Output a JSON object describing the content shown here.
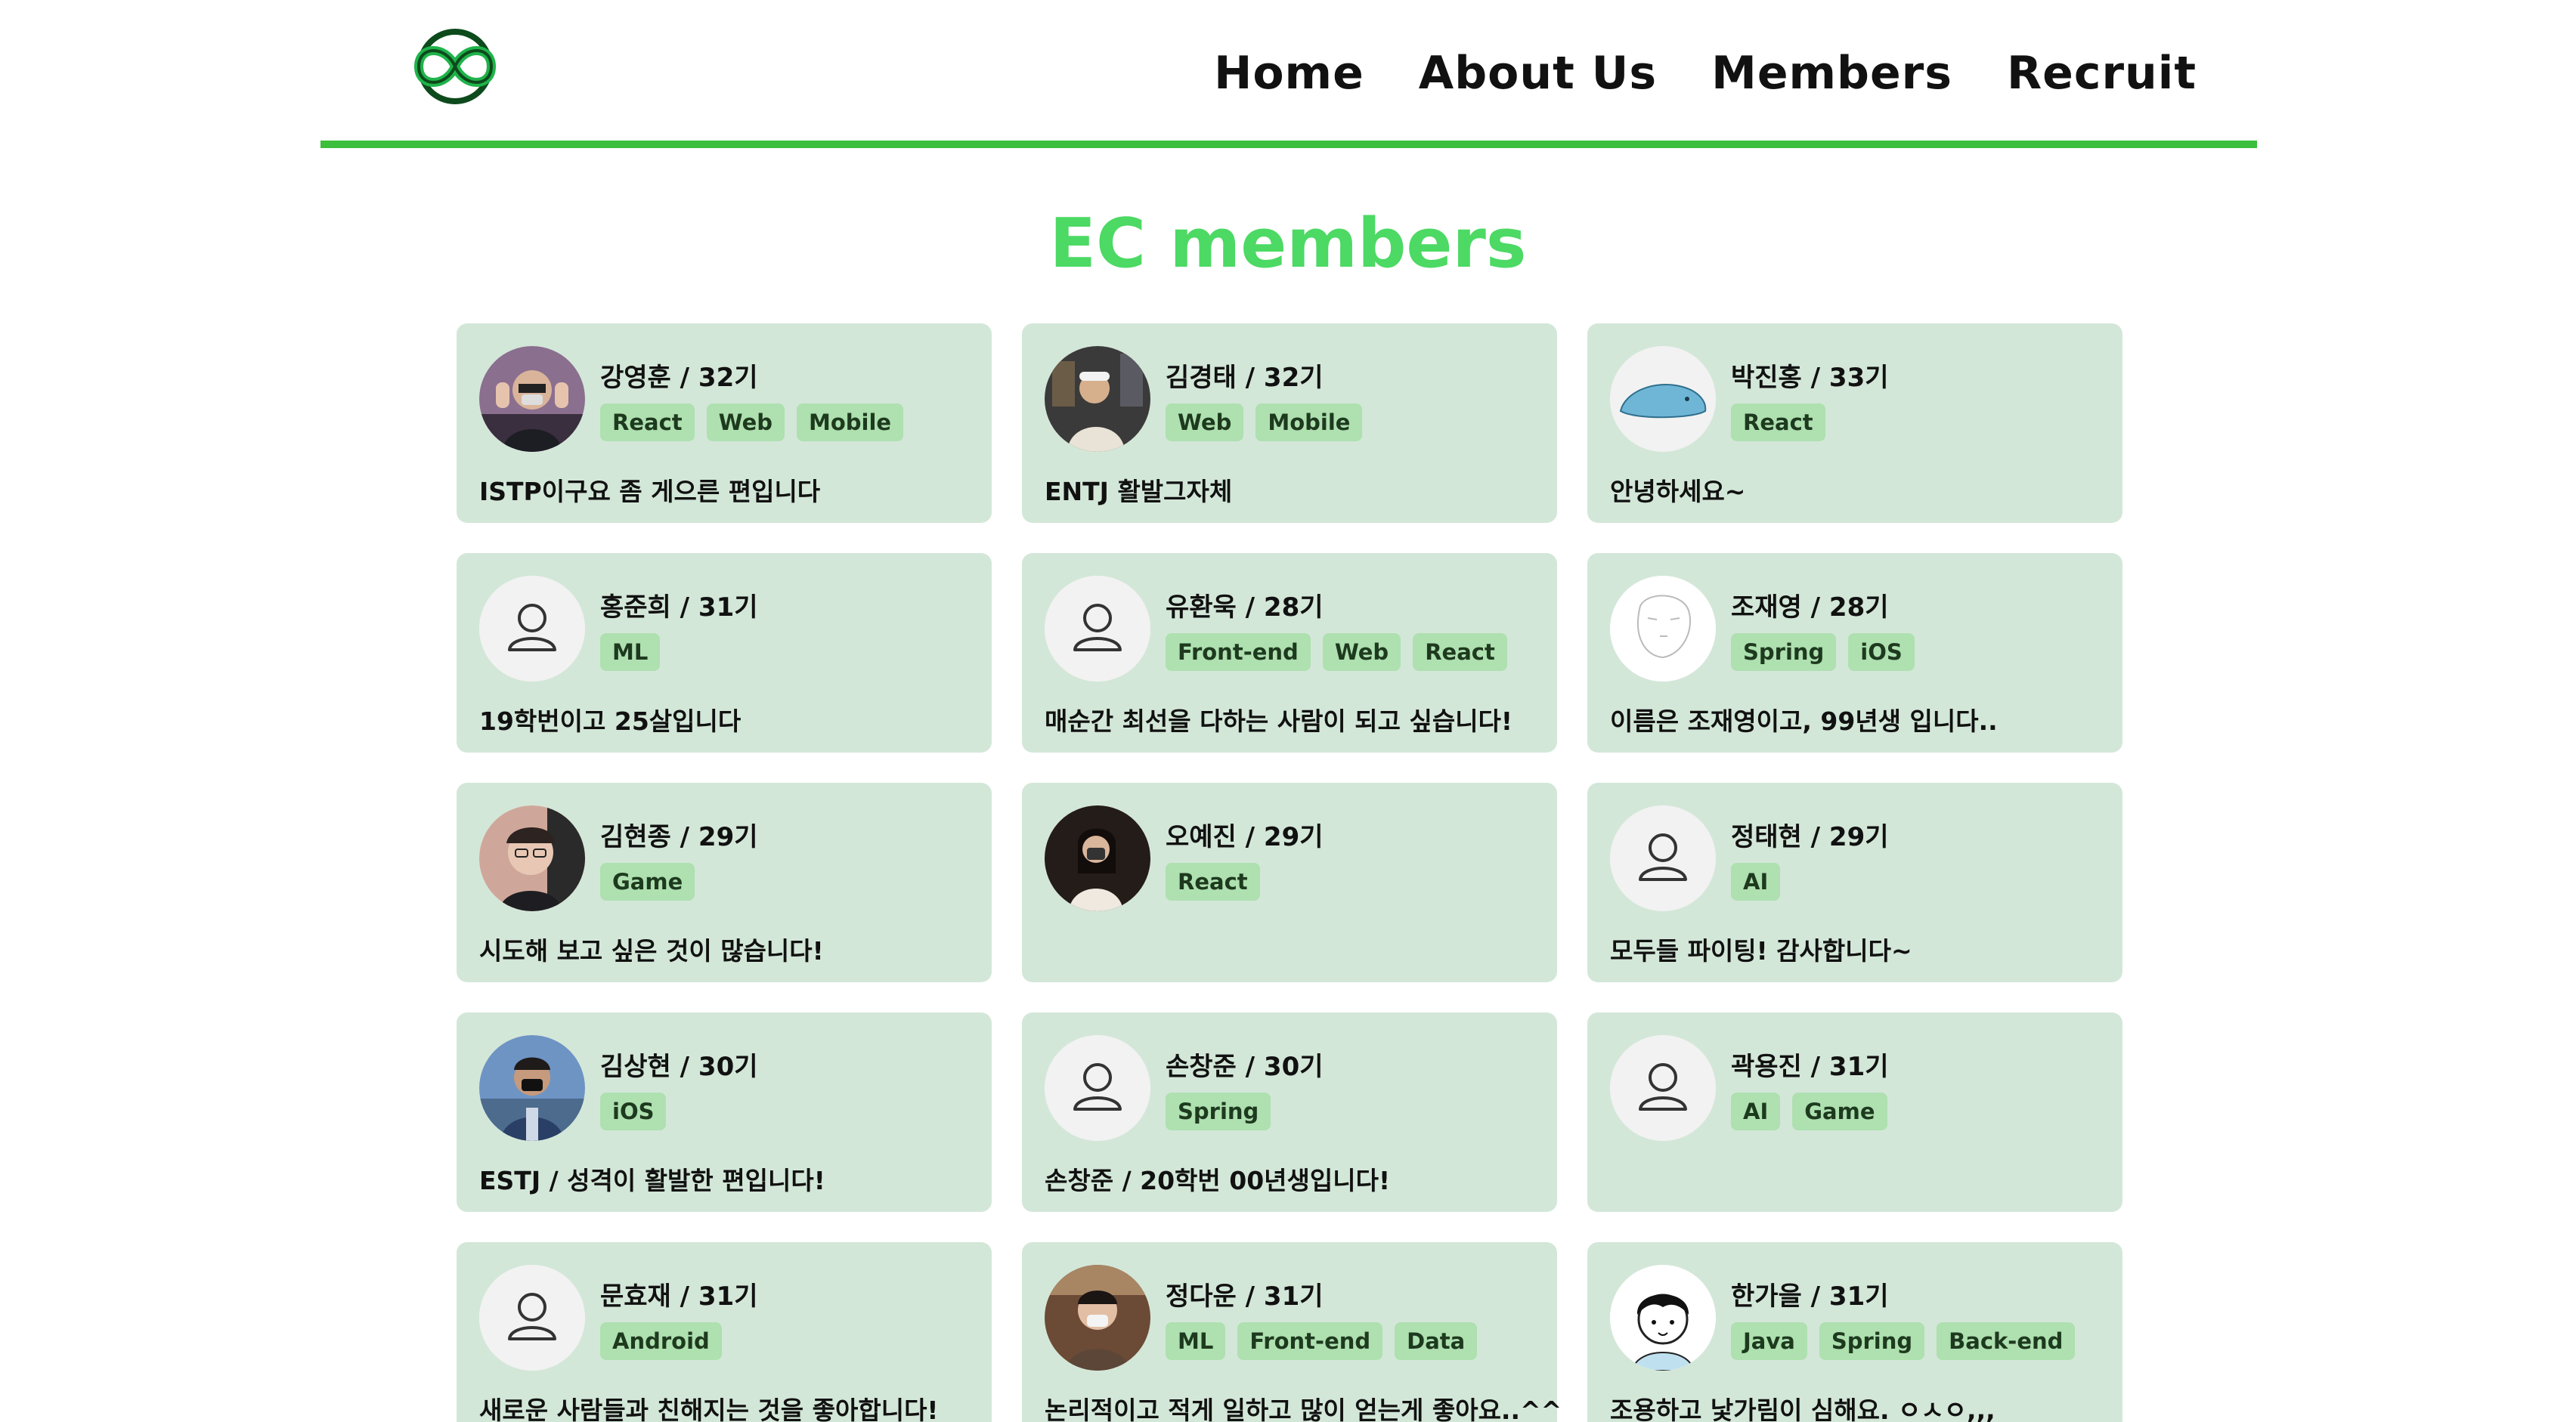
{
  "nav": {
    "home": "Home",
    "about": "About Us",
    "members": "Members",
    "recruit": "Recruit"
  },
  "section_title": "EC members",
  "colors": {
    "accent": "#3cbf3c",
    "title": "#4cd964",
    "card_bg": "#d3e7d8",
    "tag_bg": "#aee0b0"
  },
  "members": [
    {
      "name": "강영훈 / 32기",
      "tags": [
        "React",
        "Web",
        "Mobile"
      ],
      "bio": "ISTP이구요 좀 게으른 편입니다",
      "avatar": "photo-person-mask"
    },
    {
      "name": "김경태 / 32기",
      "tags": [
        "Web",
        "Mobile"
      ],
      "bio": "ENTJ 활발그자체",
      "avatar": "photo-person-night"
    },
    {
      "name": "박진홍 / 33기",
      "tags": [
        "React"
      ],
      "bio": "안녕하세요~",
      "avatar": "blue-creature-illustration"
    },
    {
      "name": "홍준희 / 31기",
      "tags": [
        "ML"
      ],
      "bio": "19학번이고 25살입니다",
      "avatar": "default-user-icon"
    },
    {
      "name": "유환욱 / 28기",
      "tags": [
        "Front-end",
        "Web",
        "React"
      ],
      "bio": "매순간 최선을 다하는 사람이 되고 싶습니다!",
      "avatar": "default-user-icon"
    },
    {
      "name": "조재영 / 28기",
      "tags": [
        "Spring",
        "iOS"
      ],
      "bio": "이름은 조재영이고, 99년생 입니다..",
      "avatar": "sketch-face-illustration"
    },
    {
      "name": "김현종 / 29기",
      "tags": [
        "Game"
      ],
      "bio": "시도해 보고 싶은 것이 많습니다!",
      "avatar": "photo-person-glasses"
    },
    {
      "name": "오예진 / 29기",
      "tags": [
        "React"
      ],
      "bio": "",
      "avatar": "photo-person-dark"
    },
    {
      "name": "정태현 / 29기",
      "tags": [
        "AI"
      ],
      "bio": "모두들 파이팅! 감사합니다~",
      "avatar": "default-user-icon"
    },
    {
      "name": "김상현 / 30기",
      "tags": [
        "iOS"
      ],
      "bio": "ESTJ / 성격이 활발한 편입니다!",
      "avatar": "photo-person-outdoor"
    },
    {
      "name": "손창준 / 30기",
      "tags": [
        "Spring"
      ],
      "bio": "손창준 / 20학번 00년생입니다!",
      "avatar": "default-user-icon"
    },
    {
      "name": "곽용진 / 31기",
      "tags": [
        "AI",
        "Game"
      ],
      "bio": "",
      "avatar": "default-user-icon"
    },
    {
      "name": "문효재 / 31기",
      "tags": [
        "Android"
      ],
      "bio": "새로운 사람들과 친해지는 것을 좋아합니다!",
      "avatar": "default-user-icon"
    },
    {
      "name": "정다운 / 31기",
      "tags": [
        "ML",
        "Front-end",
        "Data"
      ],
      "bio": "논리적이고 적게 일하고 많이 얻는게 좋아요..^^",
      "avatar": "photo-person-cafe"
    },
    {
      "name": "한가을 / 31기",
      "tags": [
        "Java",
        "Spring",
        "Back-end"
      ],
      "bio": "조용하고 낯가림이 심해요. ㅇㅅㅇ,,,",
      "avatar": "cartoon-face-illustration"
    }
  ]
}
